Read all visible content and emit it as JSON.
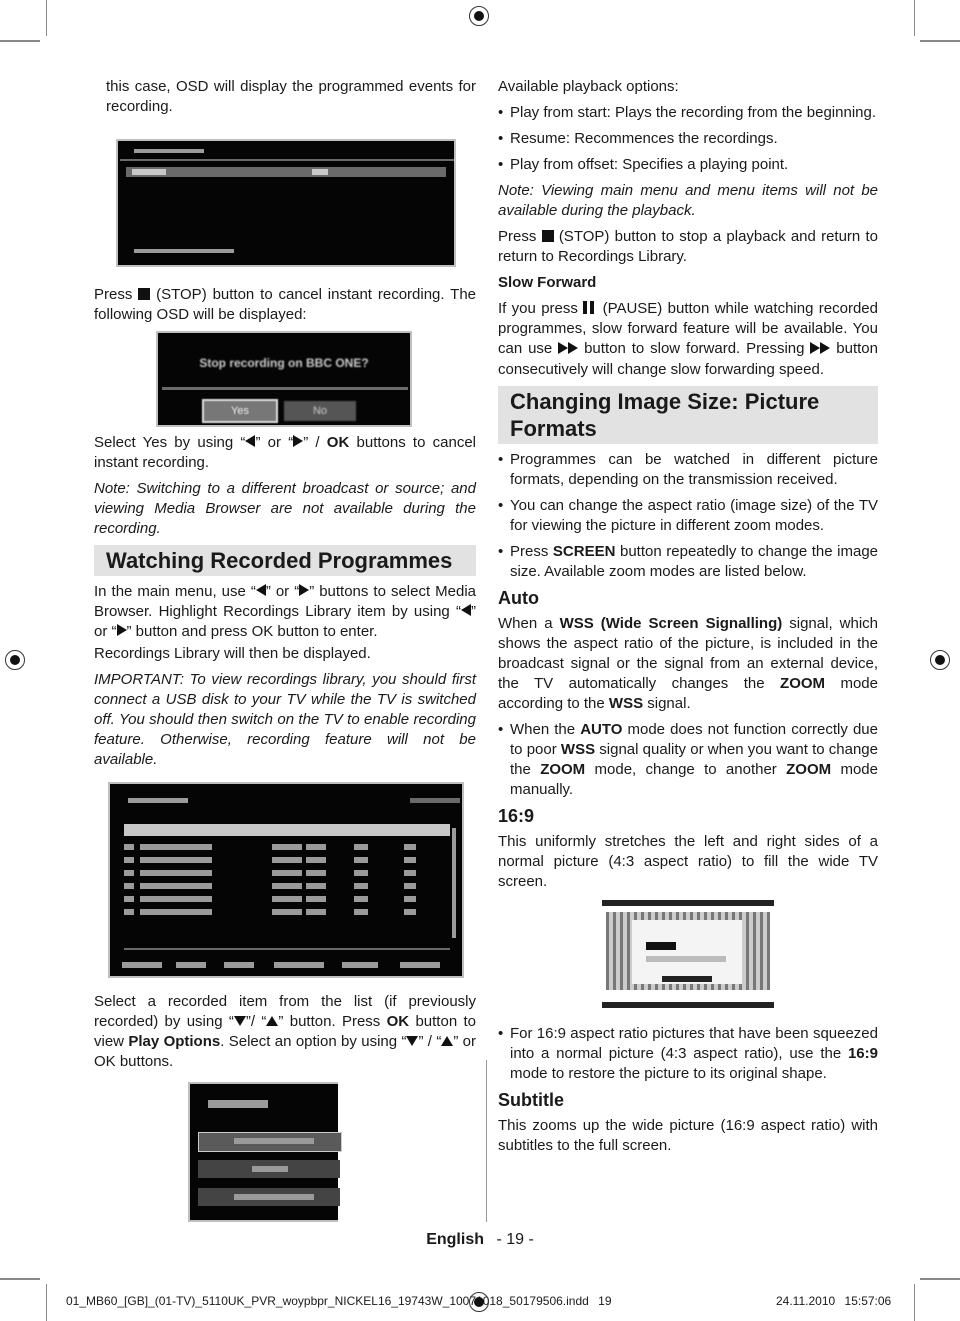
{
  "left": {
    "intro": "this case, OSD will display the programmed events for recording.",
    "press_stop_1": "Press",
    "press_stop_2": "(STOP) button to cancel instant recording. The following OSD will be displayed:",
    "osd_stop": {
      "question": "Stop recording on BBC ONE?",
      "yes": "Yes",
      "no": "No"
    },
    "select_yes_1": "Select Yes by using “",
    "select_yes_2": "” or “",
    "select_yes_3": "” / ",
    "select_yes_ok": "OK",
    "select_yes_4": " buttons to cancel instant recording.",
    "note": "Note: Switching to a different broadcast or source; and viewing Media Browser are not available during the recording.",
    "heading": "Watching Recorded Programmes",
    "main_menu_1": "In the main menu, use “",
    "main_menu_2": "” or “",
    "main_menu_3": "” buttons to select Media Browser. Highlight Recordings Library item by using “",
    "main_menu_4": "” or “",
    "main_menu_5": "” button and press OK button to enter.",
    "library_displayed": "Recordings Library will then be displayed.",
    "important": "IMPORTANT: To view recordings library, you should first connect a USB disk to your TV while the TV is switched off. You should then switch on the TV to enable recording feature. Otherwise, recording feature will not be available.",
    "select_item_1": "Select a recorded item from the list (if previously recorded) by using “",
    "select_item_2": "”/ “",
    "select_item_3": "” button. Press ",
    "select_item_ok": "OK",
    "select_item_4": " button to view ",
    "select_item_play": "Play Options",
    "select_item_5": ". Select an option by using “",
    "select_item_6": "” / “",
    "select_item_7": "” or OK buttons."
  },
  "right": {
    "available": "Available playback options:",
    "options": [
      "Play from start: Plays the recording from the beginning.",
      "Resume: Recommences the recordings.",
      "Play from offset: Specifies a playing point."
    ],
    "note": "Note: Viewing main menu and menu items will not be available during the playback.",
    "press_stop_1": "Press",
    "press_stop_2": "(STOP) button to stop a playback and return to return to Recordings Library.",
    "slow_forward_heading": "Slow Forward",
    "slow_1": "If you press",
    "slow_2": "(PAUSE) button while watching recorded programmes, slow forward feature will be available. You can use",
    "slow_3": "button to slow forward. Pressing",
    "slow_4": "button consecutively will change slow forwarding speed.",
    "heading": "Changing Image Size: Picture Formats",
    "bullets": {
      "b1": "Programmes can be watched in different picture formats, depending on the transmission received.",
      "b2": "You can change the aspect ratio (image size) of the TV for viewing the picture in different zoom modes.",
      "b3_1": "Press ",
      "b3_bold": "SCREEN",
      "b3_2": " button repeatedly to change the image size. Available zoom modes are listed below."
    },
    "auto_heading": "Auto",
    "auto_p": {
      "t1": "When a ",
      "b1": "WSS (Wide Screen Signalling)",
      "t2": " signal, which shows the aspect ratio of the picture, is included in the broadcast signal or the signal from an external device, the TV automatically changes the ",
      "b2": "ZOOM",
      "t3": " mode according to the ",
      "b3": "WSS",
      "t4": " signal."
    },
    "auto_bullet": {
      "t1": "When the ",
      "b1": "AUTO",
      "t2": " mode does not function correctly due to poor ",
      "b2": "WSS",
      "t3": " signal quality or when you want to change the ",
      "b3": "ZOOM",
      "t4": " mode, change to another ",
      "b4": "ZOOM",
      "t5": " mode manually."
    },
    "r169_heading": "16:9",
    "r169_p": "This uniformly stretches the left and right sides of a normal picture (4:3 aspect ratio) to fill the wide TV screen.",
    "r169_bullet": {
      "t1": "For 16:9 aspect ratio pictures that have been squeezed into a normal picture (4:3 aspect ratio), use the ",
      "b1": "16:9",
      "t2": " mode to restore the picture to its original shape."
    },
    "subtitle_heading": "Subtitle",
    "subtitle_p": "This zooms up the wide picture (16:9 aspect ratio) with subtitles to the full screen."
  },
  "footer": {
    "language": "English",
    "page": "- 19 -",
    "file": "01_MB60_[GB]_(01-TV)_5110UK_PVR_woypbpr_NICKEL16_19743W_10071018_50179506.indd",
    "file_page": "19",
    "date": "24.11.2010",
    "time": "15:57:06"
  }
}
